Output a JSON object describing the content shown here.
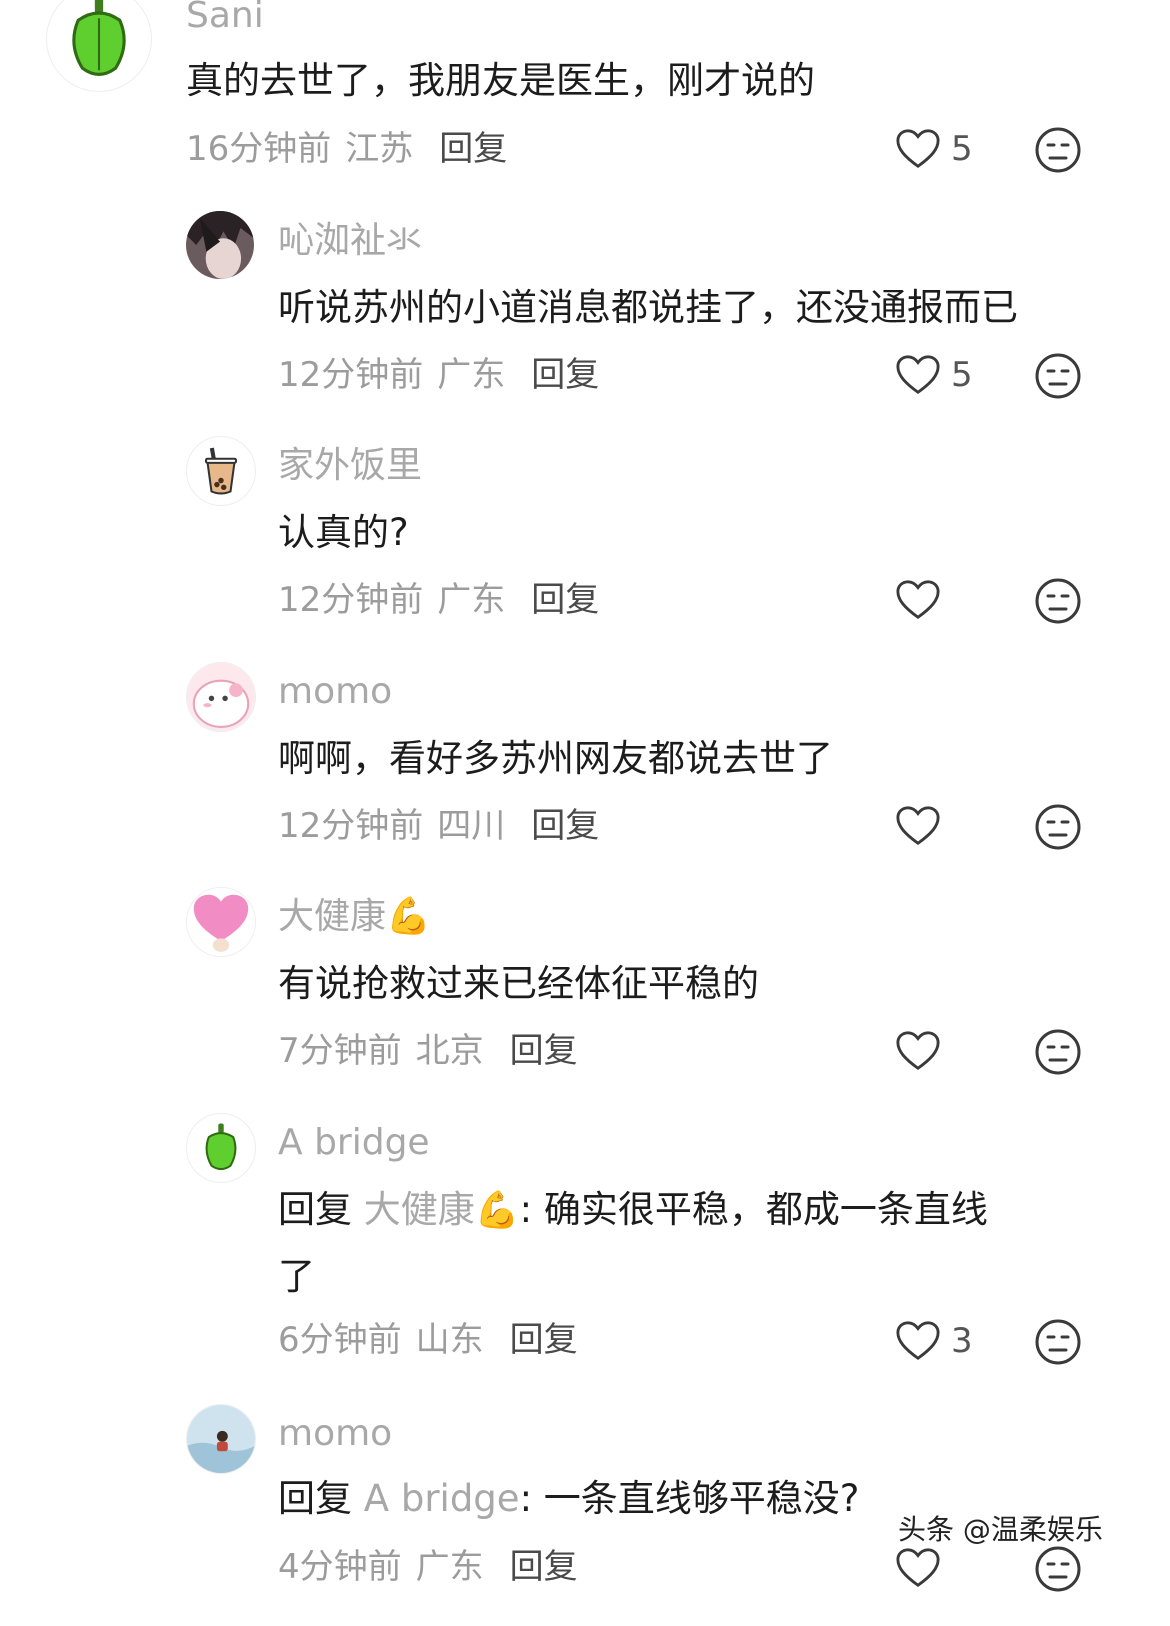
{
  "comments": [
    {
      "username": "Sani",
      "avatar_icon": "green-pepper-icon",
      "text": "真的去世了，我朋友是医生，刚才说的",
      "time": "16分钟前",
      "location": "江苏",
      "reply_label": "回复",
      "likes": "5"
    },
    {
      "username": "吣洳祉氺",
      "avatar_icon": "anime-portrait-avatar",
      "text": "听说苏州的小道消息都说挂了，还没通报而已",
      "time": "12分钟前",
      "location": "广东",
      "reply_label": "回复",
      "likes": "5"
    },
    {
      "username": "家外饭里",
      "avatar_icon": "bubble-tea-icon",
      "text": "认真的?",
      "time": "12分钟前",
      "location": "广东",
      "reply_label": "回复",
      "likes": ""
    },
    {
      "username": "momo",
      "avatar_icon": "pink-cartoon-avatar",
      "text": "啊啊，看好多苏州网友都说去世了",
      "time": "12分钟前",
      "location": "四川",
      "reply_label": "回复",
      "likes": ""
    },
    {
      "username": "大健康",
      "username_emoji": "💪",
      "avatar_icon": "pink-heart-avatar",
      "text": "有说抢救过来已经体征平稳的",
      "time": "7分钟前",
      "location": "北京",
      "reply_label": "回复",
      "likes": ""
    },
    {
      "username": "A bridge",
      "avatar_icon": "green-pepper-icon",
      "reply_prefix": "回复",
      "reply_to": "大健康",
      "reply_to_emoji": "💪",
      "text_line1": ": 确实很平稳，都成一条直线",
      "text_line2": "了",
      "time": "6分钟前",
      "location": "山东",
      "reply_label": "回复",
      "likes": "3"
    },
    {
      "username": "momo",
      "avatar_icon": "surfer-photo-avatar",
      "reply_prefix": "回复",
      "reply_to": "A bridge",
      "text_rest": ": 一条直线够平稳没?",
      "time": "4分钟前",
      "location": "广东",
      "reply_label": "回复"
    }
  ],
  "watermark": "头条 @温柔娱乐",
  "colors": {
    "background": "#ffffff",
    "username": "#a8a8a8",
    "meta": "#9c9c9c",
    "text": "#1c1c1c"
  }
}
